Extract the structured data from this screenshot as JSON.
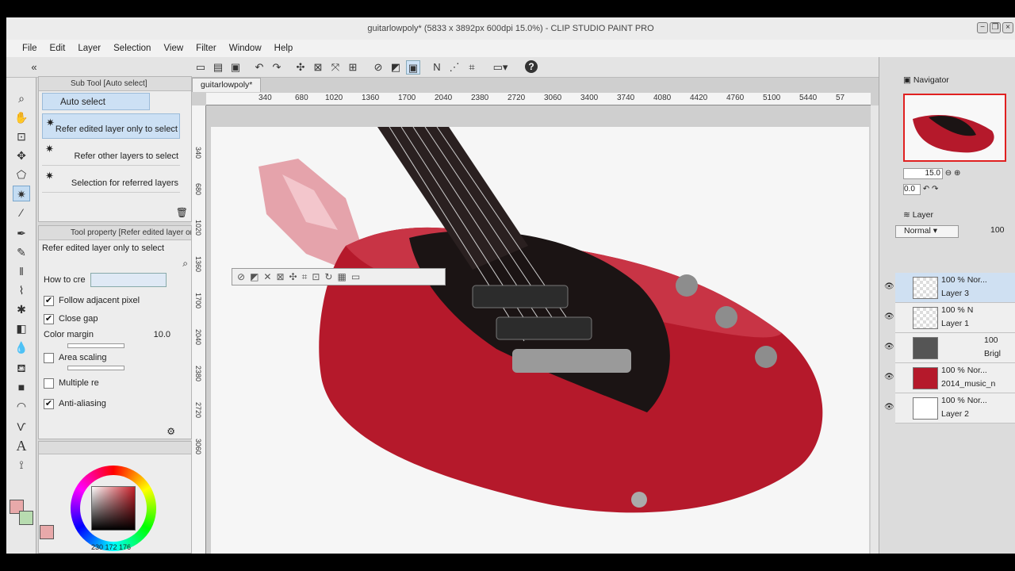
{
  "window": {
    "title": "guitarlowpoly* (5833 x 3892px 600dpi 15.0%)  - CLIP STUDIO PAINT PRO",
    "minimize": "−",
    "restore": "❐",
    "close": "×"
  },
  "menu": [
    "File",
    "Edit",
    "Layer",
    "Selection",
    "View",
    "Filter",
    "Window",
    "Help"
  ],
  "subtool": {
    "header": "Sub Tool [Auto select]",
    "active_title": "Auto select",
    "items": [
      "Refer edited layer only to select",
      "Refer other layers to select",
      "Selection for referred layers"
    ]
  },
  "tool_property": {
    "header": "Tool property [Refer edited layer only to select]",
    "title": "Refer edited layer only to select",
    "how_to_create": "How to cre",
    "follow_adjacent": "Follow adjacent pixel",
    "close_gap": "Close gap",
    "color_margin_label": "Color margin",
    "color_margin_value": "10.0",
    "area_scaling": "Area scaling",
    "multiple": "Multiple re",
    "anti_aliasing": "Anti-aliasing",
    "checks": {
      "follow_adjacent": true,
      "close_gap": true,
      "area_scaling": false,
      "multiple": false,
      "anti_aliasing": true
    }
  },
  "color": {
    "main": "#e8a9aa",
    "sub": "#b8dcb0",
    "readout": "230  172  176"
  },
  "canvas": {
    "tab": "guitarlowpoly*",
    "ruler_h": [
      "340",
      "680",
      "1020",
      "1360",
      "1700",
      "2040",
      "2380",
      "2720",
      "3060",
      "3400",
      "3740",
      "4080",
      "4420",
      "4760",
      "5100",
      "5440",
      "57"
    ],
    "ruler_v": [
      "340",
      "680",
      "1020",
      "1360",
      "1700",
      "2040",
      "2380",
      "2720",
      "3060"
    ]
  },
  "navigator": {
    "tab": "Navigator",
    "zoom": "15.0",
    "rotation": "0.0"
  },
  "layer_panel": {
    "tab": "Layer",
    "blend_mode": "Normal",
    "opacity": "100",
    "layers": [
      {
        "pct": "100 %",
        "mode": "Nor...",
        "name": "Layer 3"
      },
      {
        "pct": "100 %",
        "mode": "N",
        "name": "Layer 1"
      },
      {
        "pct": "100",
        "mode": "",
        "name": "Brigl"
      },
      {
        "pct": "100 %",
        "mode": "Nor...",
        "name": "2014_music_n"
      },
      {
        "pct": "100 %",
        "mode": "Nor...",
        "name": "Layer 2"
      }
    ]
  },
  "icons": {
    "select": "◻",
    "help": "?"
  }
}
